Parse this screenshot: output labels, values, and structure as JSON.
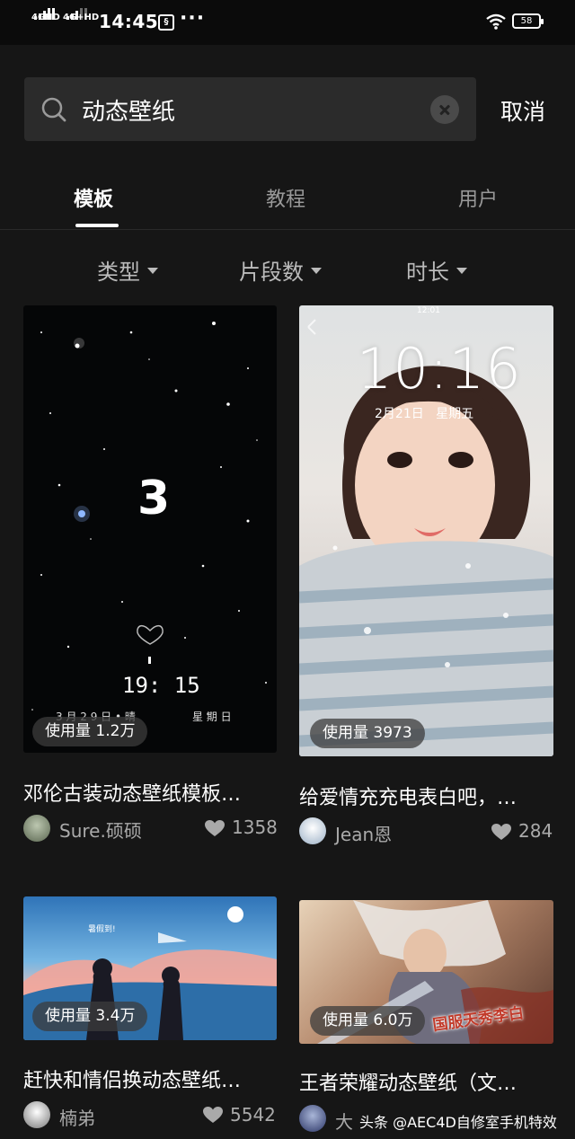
{
  "status": {
    "sig1": "4GHD",
    "sig2": "4G+HD",
    "time": "14:45",
    "tiktok_glyph": "§",
    "more": "···",
    "battery": "58"
  },
  "search": {
    "query": "动态壁纸",
    "cancel": "取消"
  },
  "tabs": [
    {
      "label": "模板",
      "active": true
    },
    {
      "label": "教程",
      "active": false
    },
    {
      "label": "用户",
      "active": false
    }
  ],
  "filters": [
    {
      "label": "类型"
    },
    {
      "label": "片段数"
    },
    {
      "label": "时长"
    }
  ],
  "cards": [
    {
      "overlay": {
        "count": "3",
        "time": "19: 15",
        "date": "3 月 2 9 日 • 晴",
        "weekday": "星 期 日"
      },
      "usage": "使用量 1.2万",
      "title": "邓伦古装动态壁纸模板…",
      "author": "Sure.硕硕",
      "likes": "1358"
    },
    {
      "overlay": {
        "clock": "10:16",
        "date": "2月21日   星期五",
        "topbar": "12:01"
      },
      "usage": "使用量 3973",
      "title": "给爱情充充电表白吧，…",
      "author": "Jean恩",
      "likes": "284"
    },
    {
      "overlay": {
        "caption": "暑假到!"
      },
      "usage": "使用量 3.4万",
      "title": "赶快和情侣换动态壁纸…",
      "author": "楠弟",
      "likes": "5542"
    },
    {
      "overlay": {
        "caption": "国服天秀李白"
      },
      "usage": "使用量 6.0万",
      "title": "王者荣耀动态壁纸（文…",
      "author": "大",
      "likes": ""
    }
  ],
  "watermark": "头条 @AEC4D自修室手机特效",
  "colors": {
    "background": "#161616",
    "search_bg": "#2b2b2b",
    "muted": "#999999"
  }
}
